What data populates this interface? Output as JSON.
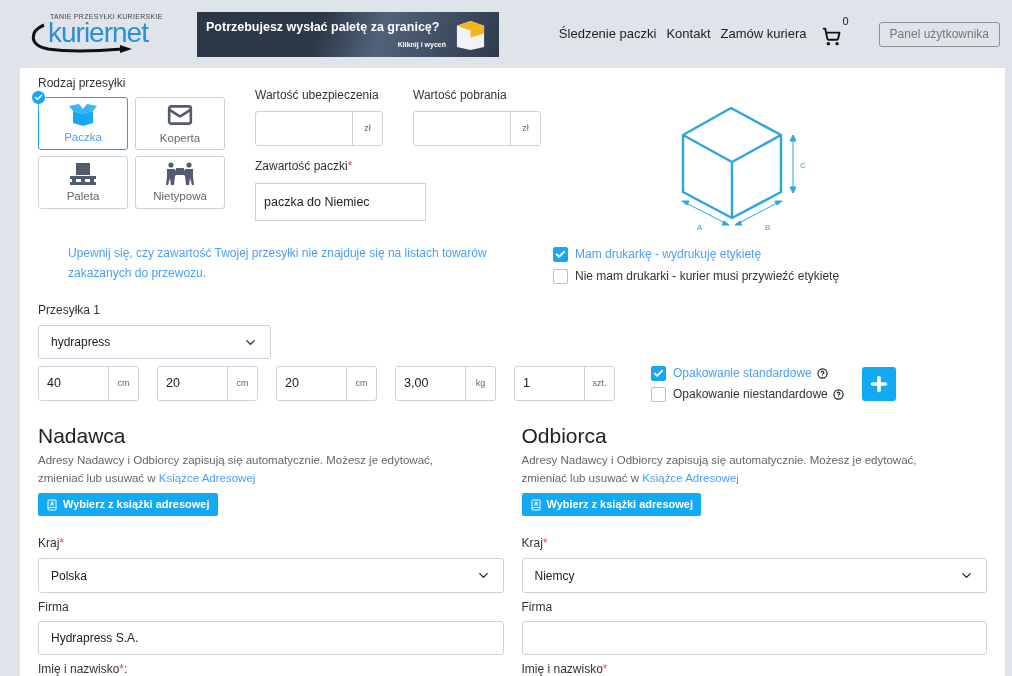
{
  "header": {
    "logo": {
      "tagline": "TANIE PRZESYŁKI KURIERSKIE",
      "name": "kuriernet"
    },
    "banner": {
      "title": "Potrzebujesz wysłać paletę za granicę?",
      "subtitle": "Kliknij i wyceń"
    },
    "nav": [
      "Śledzenie paczki",
      "Kontakt",
      "Zamów kuriera"
    ],
    "cart": {
      "count": "0"
    },
    "user_button": "Panel użytkownika"
  },
  "shipment_type": {
    "label": "Rodzaj przesyłki",
    "options": [
      {
        "label": "Paczka",
        "kind": "box",
        "selected": true
      },
      {
        "label": "Koperta",
        "kind": "envelope",
        "selected": false
      },
      {
        "label": "Paleta",
        "kind": "pallet",
        "selected": false
      },
      {
        "label": "Nietypowa",
        "kind": "carry",
        "selected": false
      }
    ]
  },
  "insurance": {
    "label": "Wartość ubezpieczenia",
    "unit": "zł"
  },
  "cod": {
    "label": "Wartość pobrania",
    "unit": "zł"
  },
  "contents": {
    "label": "Zawartość paczki",
    "required_mark": "*",
    "value": "paczka do Niemiec"
  },
  "warning": "Upewnij się, czy zawartość Twojej przesyłki nie znajduje się na listach towarów zakazanych do przewozu.",
  "dimension_labels": [
    "A",
    "B",
    "C"
  ],
  "label_options": [
    {
      "label": "Mam drukarkę - wydrukuję etykietę",
      "checked": true
    },
    {
      "label": "Nie mam drukarki - kurier musi przywieźć etykietę",
      "checked": false
    }
  ],
  "parcel": {
    "label": "Przesyłka 1",
    "template": "hydrapress",
    "measures": [
      {
        "value": "40",
        "unit": "cm"
      },
      {
        "value": "20",
        "unit": "cm"
      },
      {
        "value": "20",
        "unit": "cm"
      },
      {
        "value": "3,00",
        "unit": "kg"
      },
      {
        "value": "1",
        "unit": "szt."
      }
    ],
    "packaging": [
      {
        "label": "Opakowanie standardowe",
        "checked": true
      },
      {
        "label": "Opakowanie niestandardowe",
        "checked": false
      }
    ]
  },
  "parties": [
    {
      "title": "Nadawca",
      "note": "Adresy Nadawcy i Odbiorcy zapisują się automatycznie. Możesz je edytować, zmieniać lub usuwać w",
      "note_link": "Książce Adresowej",
      "button": "Wybierz z książki adresowej",
      "country": {
        "label": "Kraj",
        "required_mark": "*",
        "value": "Polska"
      },
      "company": {
        "label": "Firma",
        "value": "Hydrapress S.A."
      },
      "name": {
        "label": "Imię i nazwisko",
        "required_mark": "*",
        "suffix": ":"
      }
    },
    {
      "title": "Odbiorca",
      "note": "Adresy Nadawcy i Odbiorcy zapisują się automatycznie. Możesz je edytować, zmieniać lub usuwać w",
      "note_link": "Książce Adresowej",
      "button": "Wybierz z książki adresowej",
      "country": {
        "label": "Kraj",
        "required_mark": "*",
        "value": "Niemcy"
      },
      "company": {
        "label": "Firma"
      },
      "name": {
        "label": "Imię i nazwisko",
        "required_mark": "*"
      }
    }
  ]
}
